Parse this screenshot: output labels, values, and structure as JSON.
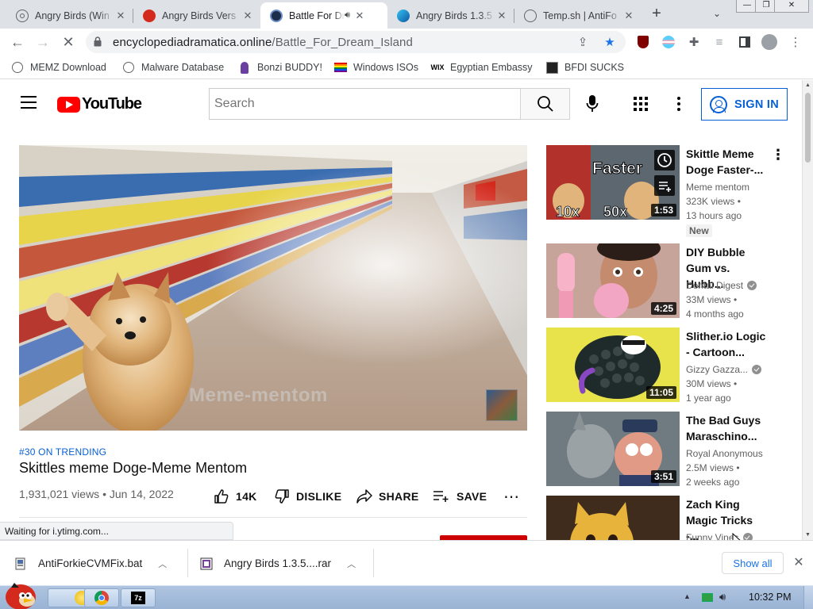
{
  "browser": {
    "tabs": [
      {
        "title": "Angry Birds (Win",
        "favicon": "generic-globe-icon",
        "active": false
      },
      {
        "title": "Angry Birds Vers",
        "favicon": "angry-bird-icon",
        "active": false
      },
      {
        "title": "Battle For Dream Island",
        "favicon": "ed-site-icon",
        "active": true,
        "audio": true
      },
      {
        "title": "Angry Birds 1.3.5",
        "favicon": "edge-icon",
        "active": false
      },
      {
        "title": "Temp.sh | AntiFo",
        "favicon": "globe-icon",
        "active": false
      }
    ],
    "url_host": "encyclopediadramatica.online",
    "url_path": "/Battle_For_Dream_Island",
    "bookmarks": [
      {
        "label": "MEMZ Download",
        "icon": "globe-icon"
      },
      {
        "label": "Malware Database",
        "icon": "globe-icon"
      },
      {
        "label": "Bonzi BUDDY!",
        "icon": "bonzi-icon"
      },
      {
        "label": "Windows ISOs",
        "icon": "rainbow-flag-icon"
      },
      {
        "label": "Egyptian Embassy",
        "icon": "wix-icon"
      },
      {
        "label": "BFDI SUCKS",
        "icon": "ed-site-icon"
      }
    ],
    "status_text": "Waiting for i.ytimg.com..."
  },
  "youtube": {
    "logo_text": "YouTube",
    "search_placeholder": "Search",
    "sign_in_label": "SIGN IN",
    "video": {
      "trending": "#30 ON TRENDING",
      "title": "Skittles meme Doge-Meme Mentom",
      "views": "1,931,021 views",
      "date": "Jun 14, 2022",
      "meta": "1,931,021 views • Jun 14, 2022",
      "likes": "14K",
      "dislike_label": "DISLIKE",
      "share_label": "SHARE",
      "save_label": "SAVE",
      "watermark": "Meme-mentom"
    },
    "recommendations": [
      {
        "title": "Skittle Meme Doge Faster-...",
        "channel": "Meme mentom",
        "verified": false,
        "views": "323K views •",
        "age": "13 hours ago",
        "badge": "New",
        "duration": "1:53",
        "thumb_text": "Faster",
        "thumb_sub1": "10x",
        "thumb_sub2": "50x"
      },
      {
        "title": "DIY Bubble Gum vs. Hubb...",
        "channel": "Dental Digest",
        "verified": true,
        "views": "33M views •",
        "age": "4 months ago",
        "duration": "4:25"
      },
      {
        "title": "Slither.io Logic - Cartoon...",
        "channel": "Gizzy Gazza...",
        "verified": true,
        "views": "30M views •",
        "age": "1 year ago",
        "duration": "11:05"
      },
      {
        "title": "The Bad Guys Maraschino...",
        "channel": "Royal Anonymous",
        "verified": false,
        "views": "2.5M views •",
        "age": "2 weeks ago",
        "duration": "3:51"
      },
      {
        "title": "Zach King Magic Tricks -...",
        "channel": "Funny Vines",
        "verified": true,
        "views": "",
        "age": "",
        "duration": ""
      }
    ]
  },
  "downloads": {
    "items": [
      {
        "name": "AntiForkieCVMFix.bat",
        "icon": "bat-file-icon"
      },
      {
        "name": "Angry Birds 1.3.5....rar",
        "icon": "rar-file-icon"
      }
    ],
    "show_all_label": "Show all"
  },
  "taskbar": {
    "clock": "10:32 PM",
    "apps": [
      "explorer-icon",
      "chrome-icon",
      "7zip-icon"
    ],
    "app_7zip_label": "7z"
  },
  "colors": {
    "yt_red": "#ff0000",
    "yt_blue": "#065fd4",
    "chrome_tabstrip": "#dee1e6",
    "taskbar": "#aec4e0"
  }
}
